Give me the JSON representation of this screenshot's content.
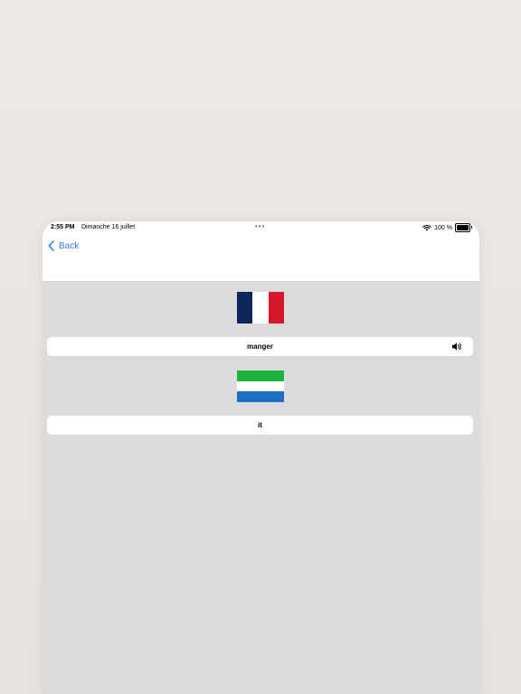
{
  "status_bar": {
    "time": "2:55 PM",
    "date": "Dimanche 16 juillet",
    "dots": "•••",
    "battery_percent": "100 %",
    "icons": [
      "wifi-icon",
      "battery-icon"
    ]
  },
  "nav": {
    "back_label": "Back",
    "back_icon": "chevron-left-icon"
  },
  "source": {
    "flag": "france-flag",
    "flag_colors": [
      "#0d2659",
      "#ffffff",
      "#d6172b"
    ],
    "word": "manger",
    "audio_icon": "speaker-icon"
  },
  "target": {
    "flag": "sierra-leone-flag",
    "flag_colors": [
      "#1db23a",
      "#ffffff",
      "#1d6fc6"
    ],
    "word": "it"
  },
  "colors": {
    "accent": "#2f7cf6",
    "content_background": "#dcdcdc",
    "page_background": "#e9e6e3"
  }
}
